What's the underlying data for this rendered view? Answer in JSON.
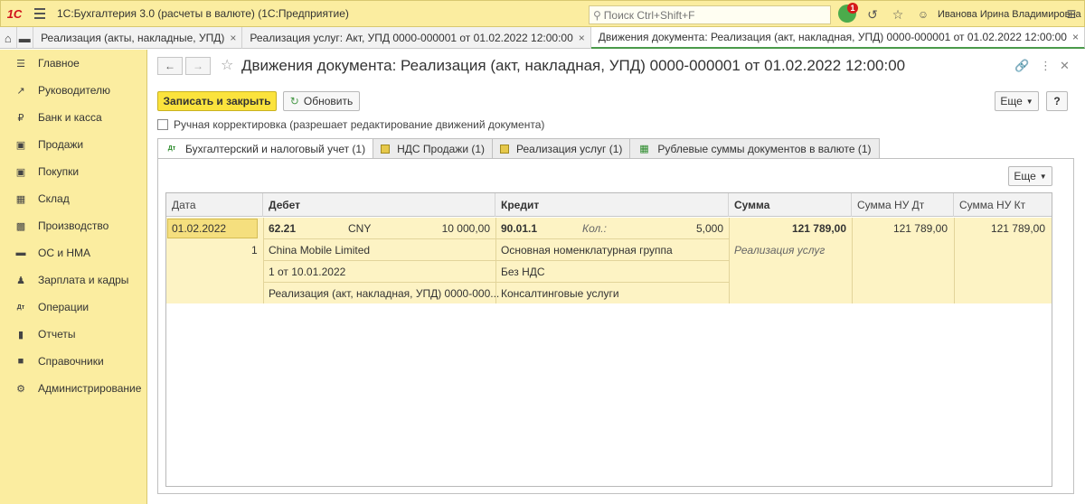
{
  "titlebar": {
    "logo": "1С",
    "app_title": "1С:Бухгалтерия 3.0 (расчеты в валюте)  (1С:Предприятие)",
    "search_placeholder": "Поиск Ctrl+Shift+F",
    "notification_count": "1",
    "user_name": "Иванова Ирина Владимировна"
  },
  "open_tabs": [
    {
      "label": "Реализация (акты, накладные, УПД)",
      "close": "×"
    },
    {
      "label": "Реализация услуг: Акт, УПД 0000-000001 от 01.02.2022 12:00:00",
      "close": "×"
    },
    {
      "label": "Движения документа: Реализация (акт, накладная, УПД) 0000-000001 от 01.02.2022 12:00:00",
      "close": "×"
    }
  ],
  "sidebar": {
    "items": [
      {
        "label": "Главное",
        "icon": "menu-icon"
      },
      {
        "label": "Руководителю",
        "icon": "chart-line-icon"
      },
      {
        "label": "Банк и касса",
        "icon": "ruble-icon"
      },
      {
        "label": "Продажи",
        "icon": "bag-icon"
      },
      {
        "label": "Покупки",
        "icon": "cart-icon"
      },
      {
        "label": "Склад",
        "icon": "warehouse-icon"
      },
      {
        "label": "Производство",
        "icon": "factory-icon"
      },
      {
        "label": "ОС и НМА",
        "icon": "truck-icon"
      },
      {
        "label": "Зарплата и кадры",
        "icon": "person-icon"
      },
      {
        "label": "Операции",
        "icon": "dt-kt-icon"
      },
      {
        "label": "Отчеты",
        "icon": "bar-chart-icon"
      },
      {
        "label": "Справочники",
        "icon": "book-icon"
      },
      {
        "label": "Администрирование",
        "icon": "gear-icon"
      }
    ]
  },
  "form": {
    "title": "Движения документа: Реализация (акт, накладная, УПД) 0000-000001 от 01.02.2022 12:00:00",
    "save_close_label": "Записать и закрыть",
    "refresh_label": "Обновить",
    "more_label": "Еще",
    "help_label": "?",
    "manual_correction_label": "Ручная корректировка (разрешает редактирование движений документа)",
    "tabs": [
      {
        "label": "Бухгалтерский и налоговый учет (1)",
        "icon": "dt-kt-icon"
      },
      {
        "label": "НДС Продажи (1)",
        "icon": "register-icon"
      },
      {
        "label": "Реализация услуг (1)",
        "icon": "register-icon"
      },
      {
        "label": "Рублевые суммы документов в валюте (1)",
        "icon": "table-icon"
      }
    ],
    "panel_more_label": "Еще"
  },
  "table": {
    "columns": [
      "Дата",
      "Дебет",
      "Кредит",
      "Сумма",
      "Сумма НУ Дт",
      "Сумма НУ Кт"
    ],
    "row": {
      "date": "01.02.2022",
      "number": "1",
      "debit_account": "62.21",
      "debit_currency": "CNY",
      "debit_currency_amount": "10 000,00",
      "debit_subconto1": "China Mobile Limited",
      "debit_subconto2": "1 от 10.01.2022",
      "debit_subconto3": "Реализация (акт, накладная, УПД) 0000-000...",
      "credit_account": "90.01.1",
      "credit_qty_label": "Кол.:",
      "credit_qty": "5,000",
      "credit_subconto1": "Основная номенклатурная группа",
      "credit_subconto2": "Без НДС",
      "credit_subconto3": "Консалтинговые услуги",
      "amount": "121 789,00",
      "content": "Реализация услуг",
      "amount_nu_dt": "121 789,00",
      "amount_nu_kt": "121 789,00"
    }
  }
}
